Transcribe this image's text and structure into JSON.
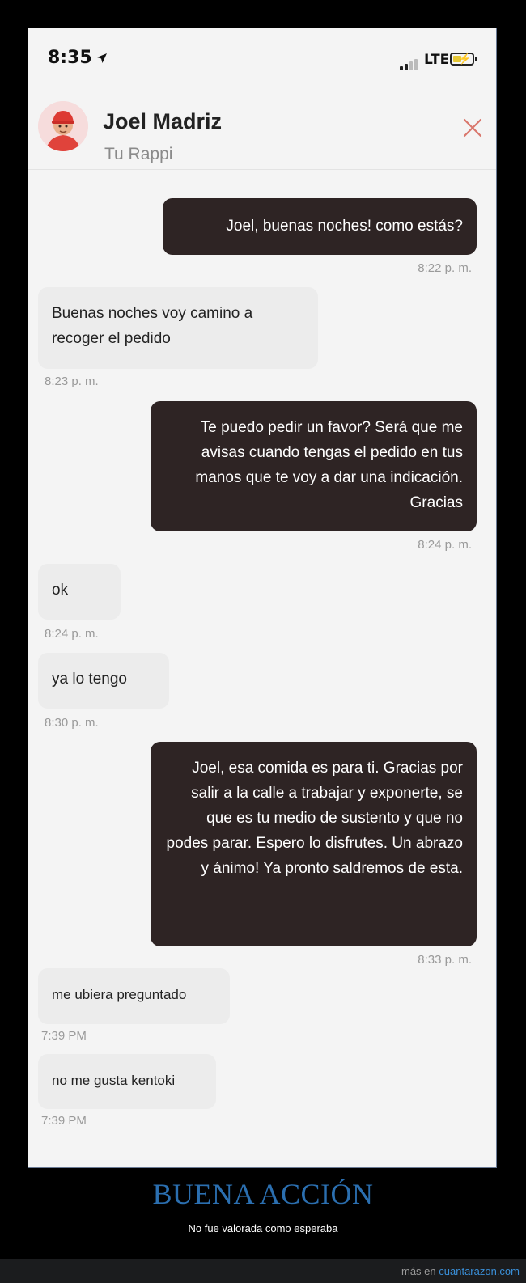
{
  "status_bar": {
    "time": "8:35",
    "network": "LTE"
  },
  "header": {
    "contact_name": "Joel Madriz",
    "subtitle": "Tu Rappi"
  },
  "messages": [
    {
      "from": "me",
      "text": "Joel, buenas noches! como estás?",
      "time": "8:22 p. m."
    },
    {
      "from": "them",
      "text": "Buenas noches voy camino a recoger el pedido",
      "time": "8:23 p. m."
    },
    {
      "from": "me",
      "text": "Te puedo pedir un favor? Será que me avisas cuando tengas el pedido en tus manos que te voy a dar una indicación. Gracias",
      "time": "8:24 p. m."
    },
    {
      "from": "them",
      "text": "ok",
      "time": "8:24 p. m."
    },
    {
      "from": "them",
      "text": "ya lo tengo",
      "time": "8:30 p. m."
    },
    {
      "from": "me",
      "text": "Joel, esa comida es para ti. Gracias por salir a la calle a trabajar y exponerte, se que es tu medio de sustento y que no podes parar. Espero lo disfrutes. Un abrazo y ánimo! Ya pronto saldremos de esta.",
      "time": "8:33 p. m."
    },
    {
      "from": "them",
      "text": "me ubiera preguntado",
      "time": "7:39 PM"
    },
    {
      "from": "them",
      "text": "no me gusta kentoki",
      "time": "7:39 PM"
    }
  ],
  "caption": {
    "title": "BUENA ACCIÓN",
    "subtitle": "No fue valorada como esperaba"
  },
  "footer": {
    "prefix": "más en",
    "site": "cuantarazon.com"
  },
  "colors": {
    "sent_bubble": "#2e2424",
    "received_bubble": "#ececec",
    "caption_title": "#2b6fb0",
    "footer_link": "#3a8fd8"
  }
}
